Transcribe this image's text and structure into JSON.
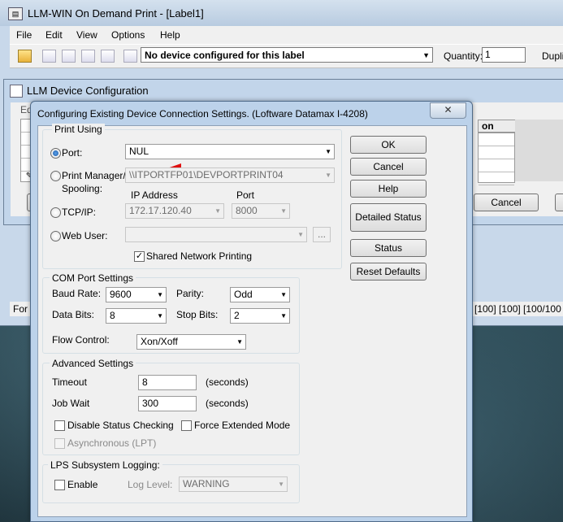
{
  "main_window": {
    "title": "LLM-WIN On Demand Print - [Label1]",
    "app_icon": "llm-app-icon",
    "menu": [
      "File",
      "Edit",
      "View",
      "Options",
      "Help"
    ],
    "device_combo": "No device configured for this label",
    "quantity_label": "Quantity:",
    "quantity_value": "1",
    "duplicate_label": "Dupli",
    "status_left": "For",
    "status_right": "[100] [100] [100/100"
  },
  "device_window": {
    "title": "LLM Device Configuration",
    "edit_menu": "Edit",
    "column_header": "on",
    "cancel_label": "Cancel"
  },
  "dialog": {
    "title": "Configuring Existing Device Connection Settings.  (Loftware Datamax I-4208)",
    "close_glyph": "✕",
    "print_using": {
      "group_label": "Print Using",
      "port_label": "Port:",
      "port_value": "NUL",
      "print_manager_label_1": "Print Manager/",
      "print_manager_label_2": "Spooling:",
      "print_manager_value": "\\\\ITPORTFP01\\DEVPORTPRINT04",
      "ip_address_header": "IP Address",
      "port_header": "Port",
      "tcpip_label": "TCP/IP:",
      "ip_value": "172.17.120.40",
      "tcp_port_value": "8000",
      "web_user_label": "Web User:",
      "web_user_value": "",
      "browse_label": "...",
      "shared_label": "Shared Network Printing",
      "shared_checked": true,
      "selected": "Port"
    },
    "com_settings": {
      "group_label": "COM Port Settings",
      "baud_label": "Baud Rate:",
      "baud_value": "9600",
      "parity_label": "Parity:",
      "parity_value": "Odd",
      "data_bits_label": "Data Bits:",
      "data_bits_value": "8",
      "stop_bits_label": "Stop Bits:",
      "stop_bits_value": "2",
      "flow_label": "Flow Control:",
      "flow_value": "Xon/Xoff"
    },
    "advanced": {
      "group_label": "Advanced Settings",
      "timeout_label": "Timeout",
      "timeout_value": "8",
      "seconds_1": "(seconds)",
      "jobwait_label": "Job Wait",
      "jobwait_value": "300",
      "seconds_2": "(seconds)",
      "disable_status_label": "Disable Status Checking",
      "force_extended_label": "Force Extended Mode",
      "async_label": "Asynchronous (LPT)"
    },
    "lps": {
      "group_label": "LPS Subsystem Logging:",
      "enable_label": "Enable",
      "log_level_label": "Log Level:",
      "log_level_value": "WARNING"
    },
    "buttons": {
      "ok": "OK",
      "cancel": "Cancel",
      "help": "Help",
      "detailed_status": "Detailed Status",
      "status": "Status",
      "reset_defaults": "Reset Defaults"
    }
  },
  "colors": {
    "annotation_arrow": "#e01010",
    "radio_selected": "#1c5aa8"
  }
}
